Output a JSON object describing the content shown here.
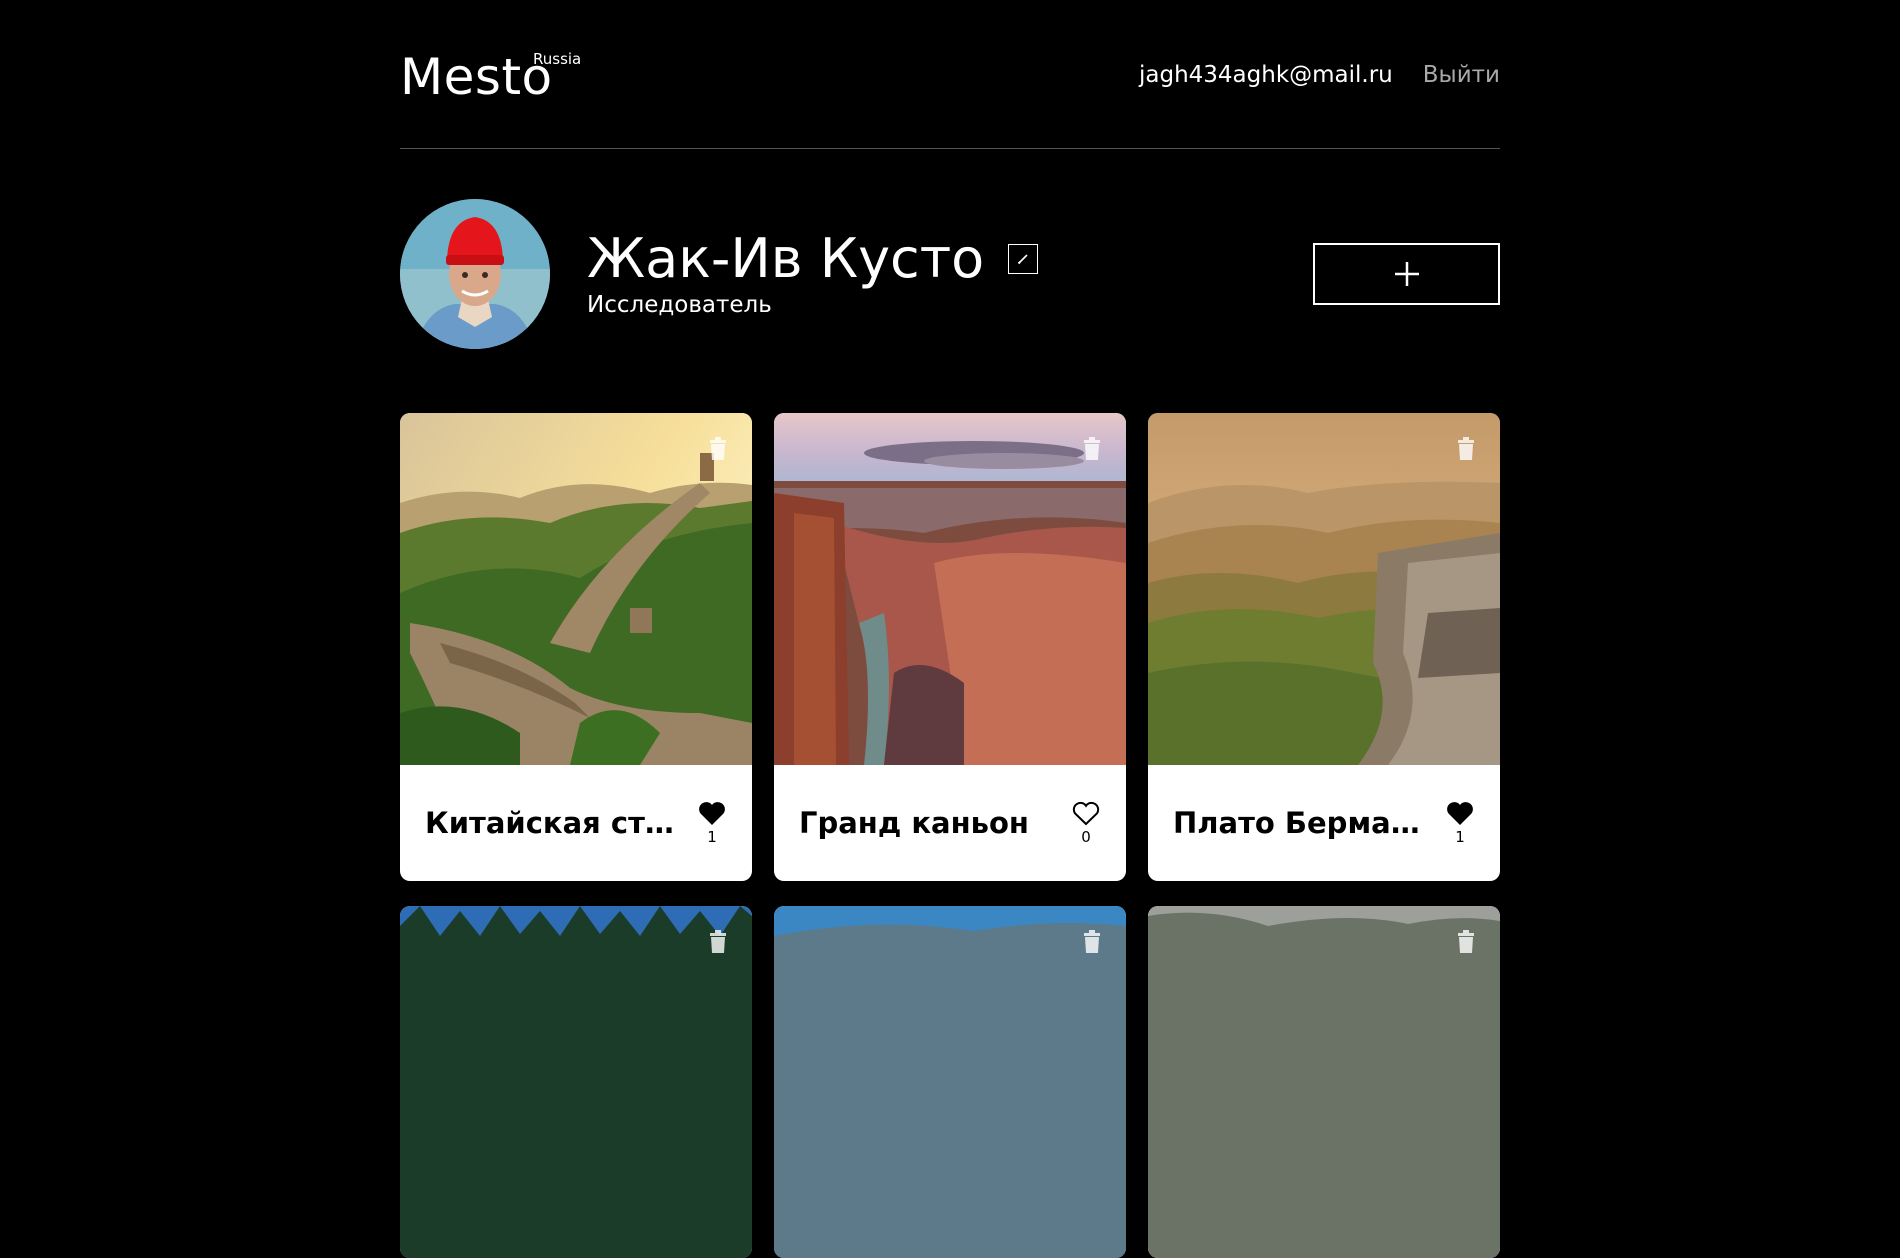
{
  "header": {
    "logo": "Mesto",
    "logo_sup": "Russia",
    "email": "jagh434aghk@mail.ru",
    "logout": "Выйти"
  },
  "profile": {
    "name": "Жак-Ив Кусто",
    "about": "Исследователь"
  },
  "icons": {
    "edit": "pencil-icon",
    "add": "plus-icon",
    "like": "heart-icon",
    "delete": "trash-icon"
  },
  "cards": [
    {
      "title": "Китайская стена",
      "likes": "1",
      "liked": true
    },
    {
      "title": "Гранд каньон",
      "likes": "0",
      "liked": false
    },
    {
      "title": "Плато Бермамыт",
      "likes": "1",
      "liked": true
    }
  ]
}
